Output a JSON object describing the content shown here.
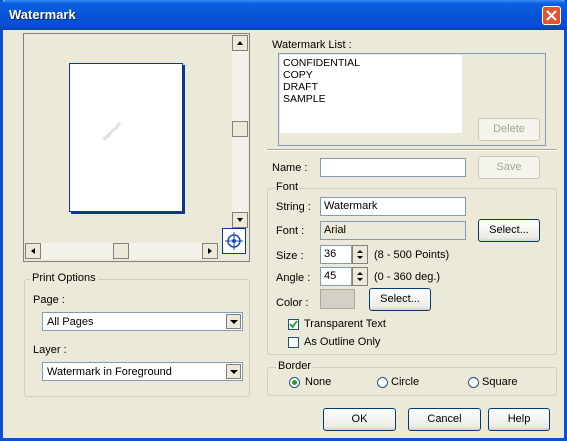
{
  "window": {
    "title": "Watermark"
  },
  "preview": {
    "watermark_text": "Watermark"
  },
  "print_options": {
    "legend": "Print Options",
    "page_label": "Page :",
    "page_value": "All Pages",
    "layer_label": "Layer :",
    "layer_value": "Watermark in Foreground"
  },
  "watermark_list": {
    "label": "Watermark List :",
    "items": [
      "CONFIDENTIAL",
      "COPY",
      "DRAFT",
      "SAMPLE"
    ],
    "delete_label": "Delete"
  },
  "name": {
    "label": "Name :",
    "value": "",
    "save_label": "Save"
  },
  "font_group": {
    "legend": "Font",
    "string_label": "String :",
    "string_value": "Watermark",
    "font_label": "Font :",
    "font_value": "Arial",
    "font_select_label": "Select...",
    "size_label": "Size :",
    "size_value": "36",
    "size_range": "(8 - 500 Points)",
    "angle_label": "Angle :",
    "angle_value": "45",
    "angle_range": "(0 - 360 deg.)",
    "color_label": "Color :",
    "color_select_label": "Select...",
    "transparent_label": "Transparent Text",
    "transparent_checked": true,
    "outline_label": "As Outline Only",
    "outline_checked": false
  },
  "border_group": {
    "legend": "Border",
    "options": [
      "None",
      "Circle",
      "Square"
    ],
    "selected": "None"
  },
  "buttons": {
    "ok": "OK",
    "cancel": "Cancel",
    "help": "Help"
  }
}
